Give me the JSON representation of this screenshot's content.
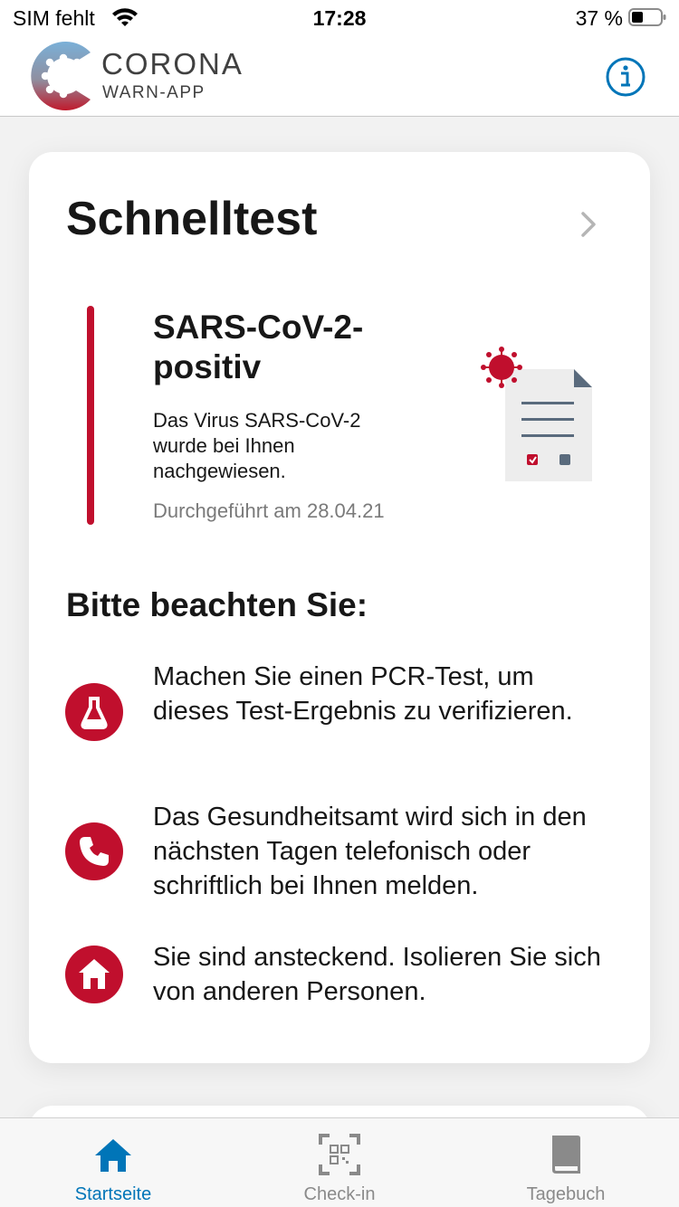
{
  "status_bar": {
    "carrier": "SIM fehlt",
    "time": "17:28",
    "battery": "37 %"
  },
  "header": {
    "logo_line1": "CORONA",
    "logo_line2": "WARN-APP",
    "info_icon": "info-icon"
  },
  "card": {
    "title": "Schnelltest",
    "result": {
      "title": "SARS-CoV-2-positiv",
      "description": "Das Virus SARS-CoV-2 wurde bei Ihnen nachgewiesen.",
      "date": "Durchgeführt am 28.04.21"
    },
    "notice_title": "Bitte beachten Sie:",
    "hints": [
      {
        "icon": "flask-icon",
        "text": "Machen Sie einen PCR-Test, um dieses Test-Ergebnis zu verifizieren."
      },
      {
        "icon": "phone-icon",
        "text": "Das Gesundheitsamt wird sich in den nächsten Tagen telefonisch oder schriftlich bei Ihnen melden."
      },
      {
        "icon": "home-icon",
        "text": "Sie sind ansteckend. Isolieren Sie sich von anderen Personen."
      }
    ]
  },
  "tabs": [
    {
      "label": "Startseite",
      "icon": "home-icon",
      "active": true
    },
    {
      "label": "Check-in",
      "icon": "qr-code-icon",
      "active": false
    },
    {
      "label": "Tagebuch",
      "icon": "book-icon",
      "active": false
    }
  ],
  "colors": {
    "accent_red": "#c00f2d",
    "accent_blue": "#0075b8"
  }
}
